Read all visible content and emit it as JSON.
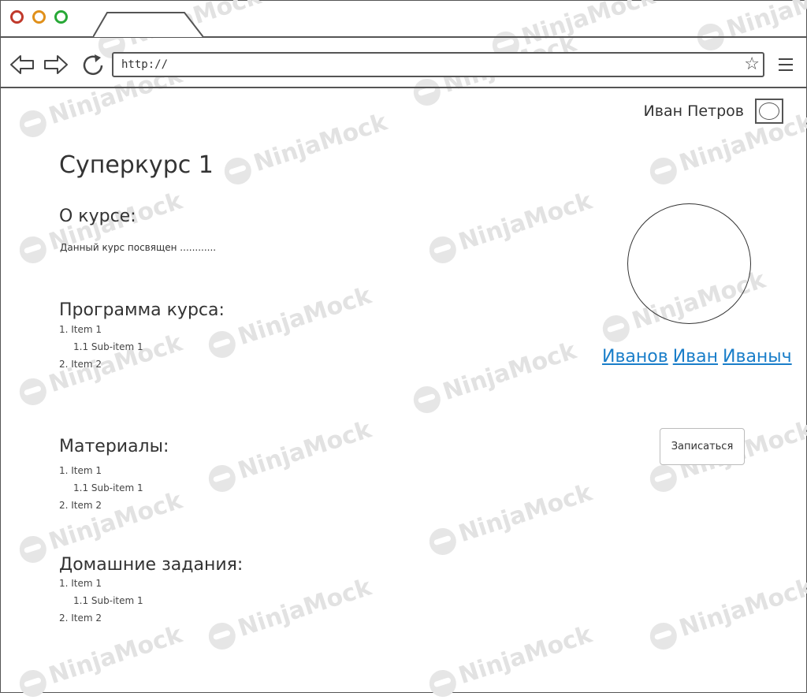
{
  "browser": {
    "url": "http://",
    "star_icon": "star-icon",
    "menu_icon": "hamburger-menu-icon"
  },
  "user": {
    "name": "Иван Петров"
  },
  "course": {
    "title": "Суперкурс 1",
    "about_heading": "О курсе:",
    "about_text": "Данный курс посвящен ............",
    "program_heading": "Программа курса:",
    "program_items": [
      "1. Item 1",
      "1.1 Sub-item 1",
      "2. Item 2"
    ],
    "materials_heading": "Материалы:",
    "materials_items": [
      "1. Item 1",
      "1.1 Sub-item 1",
      "2. Item 2"
    ],
    "homework_heading": "Домашние задания:",
    "homework_items": [
      "1. Item 1",
      "1.1 Sub-item 1",
      "2. Item 2"
    ]
  },
  "teacher": {
    "last": "Иванов",
    "first": "Иван",
    "middle": "Иваныч"
  },
  "enroll_button": "Записаться",
  "watermark": "NinjaMock",
  "colors": {
    "link": "#1a7ec9",
    "close": "#c0392b",
    "minimize": "#e0901a",
    "maximize": "#27a836"
  }
}
